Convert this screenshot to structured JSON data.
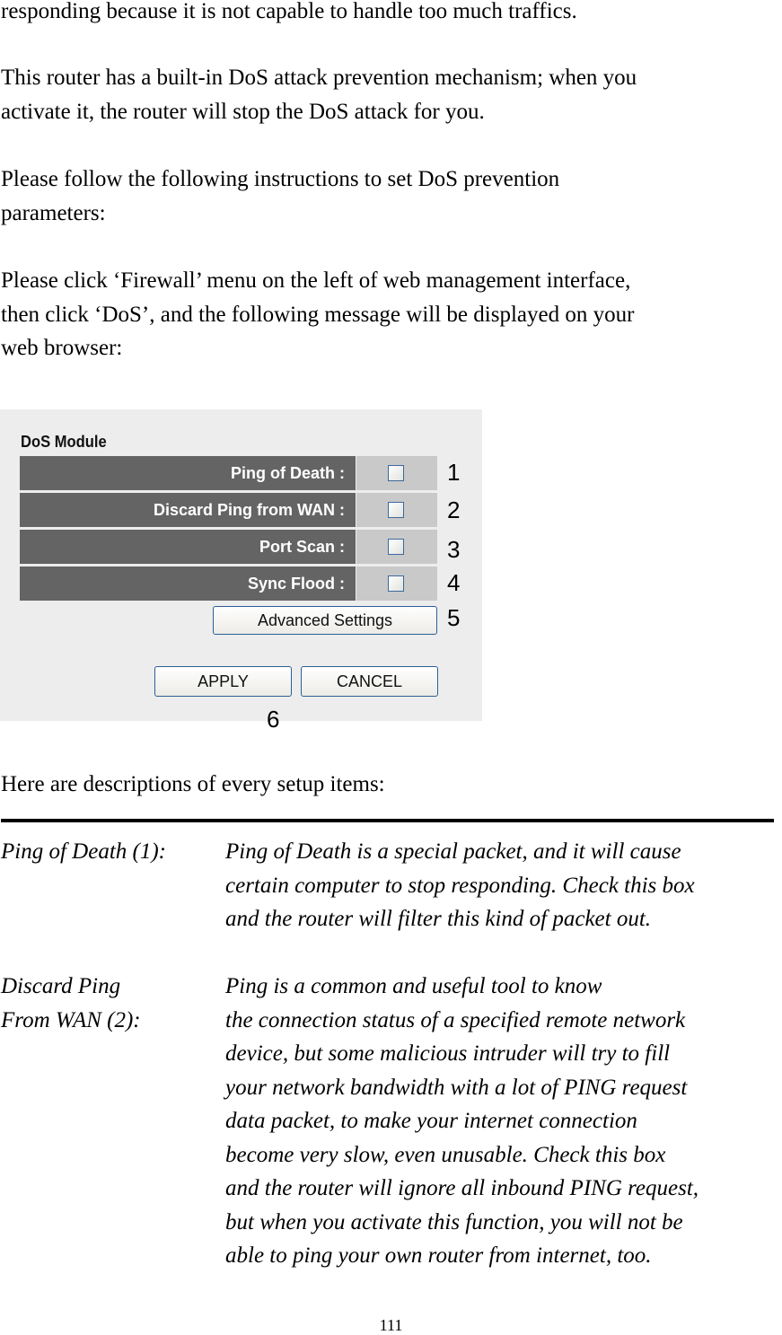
{
  "intro": {
    "p1": "responding because it is not capable to handle too much traffics.",
    "p2": "This router has a built-in DoS attack prevention mechanism; when you\nactivate it, the router will stop the DoS attack for you.",
    "p3": "Please follow the following instructions to set DoS prevention\nparameters:",
    "p4": "Please click ‘Firewall’ menu on the left of web management interface,\nthen click ‘DoS’, and the following message will be displayed on your\nweb browser:"
  },
  "screenshot": {
    "title": "DoS Module",
    "rows": [
      {
        "label": "Ping of Death :",
        "checked": false,
        "marker": "1"
      },
      {
        "label": "Discard Ping from WAN :",
        "checked": false,
        "marker": "2"
      },
      {
        "label": "Port Scan :",
        "checked": false,
        "marker": "3"
      },
      {
        "label": "Sync Flood :",
        "checked": false,
        "marker": "4"
      }
    ],
    "advanced_button": "Advanced Settings",
    "advanced_marker": "5",
    "apply_button": "APPLY",
    "cancel_button": "CANCEL",
    "buttons_marker": "6"
  },
  "descriptions_heading": "Here are descriptions of every setup items:",
  "items": [
    {
      "term": "Ping of Death (1):",
      "description": "Ping of Death is a special packet, and it will cause\ncertain computer to stop responding. Check this box\nand the router will filter this kind of packet out."
    },
    {
      "term": "Discard Ping\nFrom WAN (2):",
      "description": "Ping is a common and useful tool to know\nthe connection status of a specified remote network\ndevice, but some malicious intruder will try to fill\nyour network bandwidth with a lot of PING request\ndata packet, to make your internet connection\nbecome very slow, even unusable. Check this box\nand the router will ignore all inbound PING request,\nbut when you activate this function, you will not be\nable to ping your own router from internet, too."
    }
  ],
  "page_number": "111"
}
